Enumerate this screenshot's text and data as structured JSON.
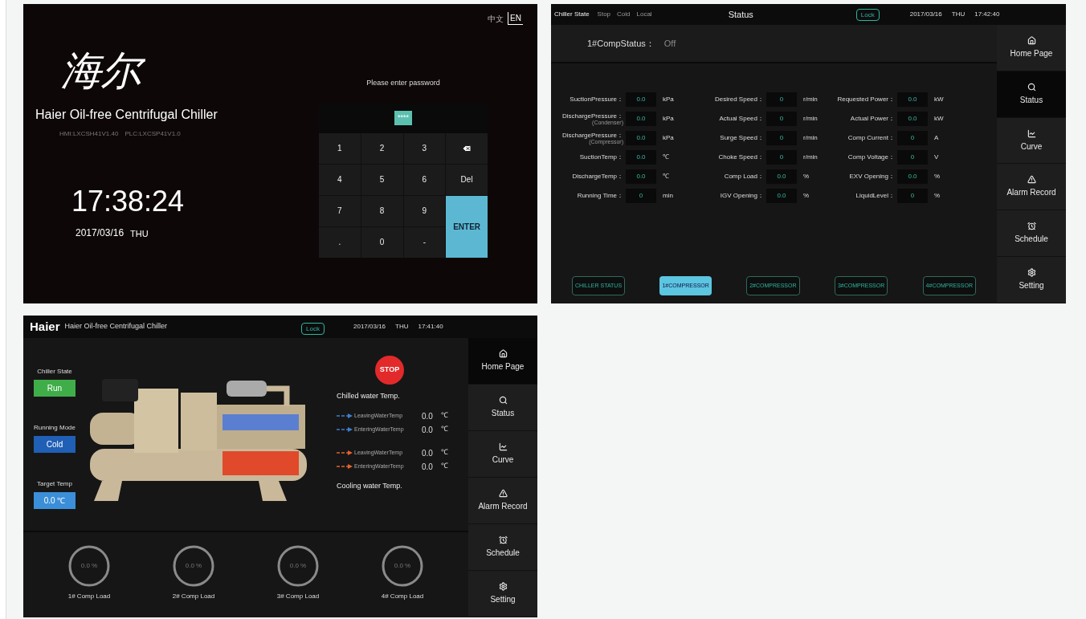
{
  "login_screen": {
    "language_options": [
      {
        "label": "中文",
        "selected": false
      },
      {
        "label": "EN",
        "selected": true
      }
    ],
    "logo": "海尔",
    "title": "Haier Oil-free Centrifugal Chiller",
    "versions": [
      "HMI:LXCSH41V1.40",
      "PLC:LXCSP41V1.0"
    ],
    "time": "17:38:24",
    "date": "2017/03/16",
    "weekday": "THU",
    "prompt": "Please enter password",
    "password_value": "****",
    "keys": [
      {
        "kind": "key",
        "label": "1"
      },
      {
        "kind": "key",
        "label": "2"
      },
      {
        "kind": "key",
        "label": "3"
      },
      {
        "kind": "backspace"
      },
      {
        "kind": "key",
        "label": "4"
      },
      {
        "kind": "key",
        "label": "5"
      },
      {
        "kind": "key",
        "label": "6"
      },
      {
        "kind": "key",
        "label": "Del"
      },
      {
        "kind": "key",
        "label": "7"
      },
      {
        "kind": "key",
        "label": "8"
      },
      {
        "kind": "key",
        "label": "9"
      },
      {
        "kind": "enter",
        "label": "ENTER"
      },
      {
        "kind": "key",
        "label": "."
      },
      {
        "kind": "key",
        "label": "0"
      },
      {
        "kind": "key",
        "label": "-"
      }
    ]
  },
  "status_screen": {
    "top_bar": {
      "state_label": "Chiller State",
      "states": [
        "Stop",
        "Cold",
        "Local"
      ],
      "title": "Status",
      "lock": "Lock",
      "date": "2017/03/16",
      "weekday": "THU",
      "time": "17:42:40"
    },
    "comp_status": {
      "label": "1#CompStatus：",
      "value": "Off"
    },
    "rows": [
      [
        {
          "label": "SuctionPressure：",
          "value": "0.0",
          "unit": "kPa"
        },
        {
          "label": "Desired Speed：",
          "value": "0",
          "unit": "r/min"
        },
        {
          "label": "Requested Power：",
          "value": "0.0",
          "unit": "kW"
        }
      ],
      [
        {
          "label": "DischargePressure：",
          "sublabel": "(Condenser)",
          "value": "0.0",
          "unit": "kPa"
        },
        {
          "label": "Actual Speed：",
          "value": "0",
          "unit": "r/min"
        },
        {
          "label": "Actual Power：",
          "value": "0.0",
          "unit": "kW"
        }
      ],
      [
        {
          "label": "DischargePressure：",
          "sublabel": "(Compressor)",
          "value": "0.0",
          "unit": "kPa"
        },
        {
          "label": "Surge Speed：",
          "value": "0",
          "unit": "r/min"
        },
        {
          "label": "Comp Current：",
          "value": "0",
          "unit": "A"
        }
      ],
      [
        {
          "label": "SuctionTemp：",
          "value": "0.0",
          "unit": "℃"
        },
        {
          "label": "Choke Speed：",
          "value": "0",
          "unit": "r/min"
        },
        {
          "label": "Comp Voltage：",
          "value": "0",
          "unit": "V"
        }
      ],
      [
        {
          "label": "DischargeTemp：",
          "value": "0.0",
          "unit": "℃"
        },
        {
          "label": "Comp Load：",
          "value": "0.0",
          "unit": "%"
        },
        {
          "label": "EXV Opening：",
          "value": "0.0",
          "unit": "%"
        }
      ],
      [
        {
          "label": "Running Time：",
          "value": "0",
          "unit": "min"
        },
        {
          "label": "IGV Opening：",
          "value": "0.0",
          "unit": "%"
        },
        {
          "label": "LiquidLevel：",
          "value": "0",
          "unit": "%"
        }
      ]
    ],
    "tabs": [
      {
        "label": "CHILLER STATUS",
        "selected": false
      },
      {
        "label": "1#COMPRESSOR",
        "selected": true
      },
      {
        "label": "2#COMPRESSOR",
        "selected": false
      },
      {
        "label": "3#COMPRESSOR",
        "selected": false
      },
      {
        "label": "4#COMPRESSOR",
        "selected": false
      }
    ],
    "sidebar": [
      {
        "kind": "home",
        "label": "Home Page",
        "selected": false
      },
      {
        "kind": "search",
        "label": "Status",
        "selected": true
      },
      {
        "kind": "curve",
        "label": "Curve",
        "selected": false
      },
      {
        "kind": "alarm",
        "label": "Alarm Record",
        "selected": false
      },
      {
        "kind": "schedule",
        "label": "Schedule",
        "selected": false
      },
      {
        "kind": "setting",
        "label": "Setting",
        "selected": false
      }
    ]
  },
  "home_screen": {
    "header": {
      "brand": "Haier",
      "title": "Haier Oil-free Centrifugal Chiller",
      "lock": "Lock",
      "date": "2017/03/16",
      "weekday": "THU",
      "time": "17:41:40"
    },
    "indicators": [
      {
        "label": "Chiller State",
        "value": "Run",
        "color": "#3fae49"
      },
      {
        "label": "Running Mode",
        "value": "Cold",
        "color": "#1f5fb5"
      },
      {
        "label": "Target Temp",
        "value": "0.0 ℃",
        "color": "#3b8fd8"
      }
    ],
    "stop_button": "STOP",
    "water_groups": [
      {
        "kind": "chilled",
        "title": "Chilled water Temp.",
        "color": "#3d7fd0",
        "readings": [
          {
            "label": "LeavingWaterTemp",
            "value": "0.0",
            "unit": "℃"
          },
          {
            "label": "EnteringWaterTemp",
            "value": "0.0",
            "unit": "℃"
          }
        ]
      },
      {
        "kind": "cooling",
        "title": "Cooling water Temp.",
        "color": "#e2622f",
        "readings": [
          {
            "label": "LeavingWaterTemp",
            "value": "0.0",
            "unit": "℃"
          },
          {
            "label": "EnteringWaterTemp",
            "value": "0.0",
            "unit": "℃"
          }
        ]
      }
    ],
    "gauges": [
      {
        "value": "0.0 %",
        "label": "1# Comp Load",
        "level": 0
      },
      {
        "value": "0.0 %",
        "label": "2# Comp Load",
        "level": 0
      },
      {
        "value": "0.0 %",
        "label": "3# Comp Load",
        "level": 0
      },
      {
        "value": "0.0 %",
        "label": "4# Comp Load",
        "level": 0
      }
    ],
    "sidebar": [
      {
        "kind": "home",
        "label": "Home Page",
        "selected": true
      },
      {
        "kind": "search",
        "label": "Status",
        "selected": false
      },
      {
        "kind": "curve",
        "label": "Curve",
        "selected": false
      },
      {
        "kind": "alarm",
        "label": "Alarm Record",
        "selected": false
      },
      {
        "kind": "schedule",
        "label": "Schedule",
        "selected": false
      },
      {
        "kind": "setting",
        "label": "Setting",
        "selected": false
      }
    ]
  }
}
